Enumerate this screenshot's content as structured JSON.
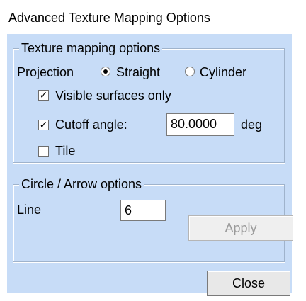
{
  "window": {
    "title": "Advanced Texture Mapping Options"
  },
  "texture_group": {
    "legend": "Texture mapping options",
    "projection_label": "Projection",
    "projection_options": [
      {
        "label": "Straight",
        "selected": true
      },
      {
        "label": "Cylinder",
        "selected": false
      }
    ],
    "visible_surfaces": {
      "label": "Visible surfaces only",
      "checked": true
    },
    "cutoff_angle": {
      "label": "Cutoff angle:",
      "checked": true,
      "value": "80.0000",
      "unit": "deg"
    },
    "tile": {
      "label": "Tile",
      "checked": false
    }
  },
  "circle_group": {
    "legend": "Circle / Arrow options",
    "line_label": "Line",
    "line_value": "6",
    "apply_label": "Apply"
  },
  "footer": {
    "close_label": "Close"
  },
  "colors": {
    "panel_background": "#c7dcf7",
    "disabled_text": "#9a9a9a"
  }
}
